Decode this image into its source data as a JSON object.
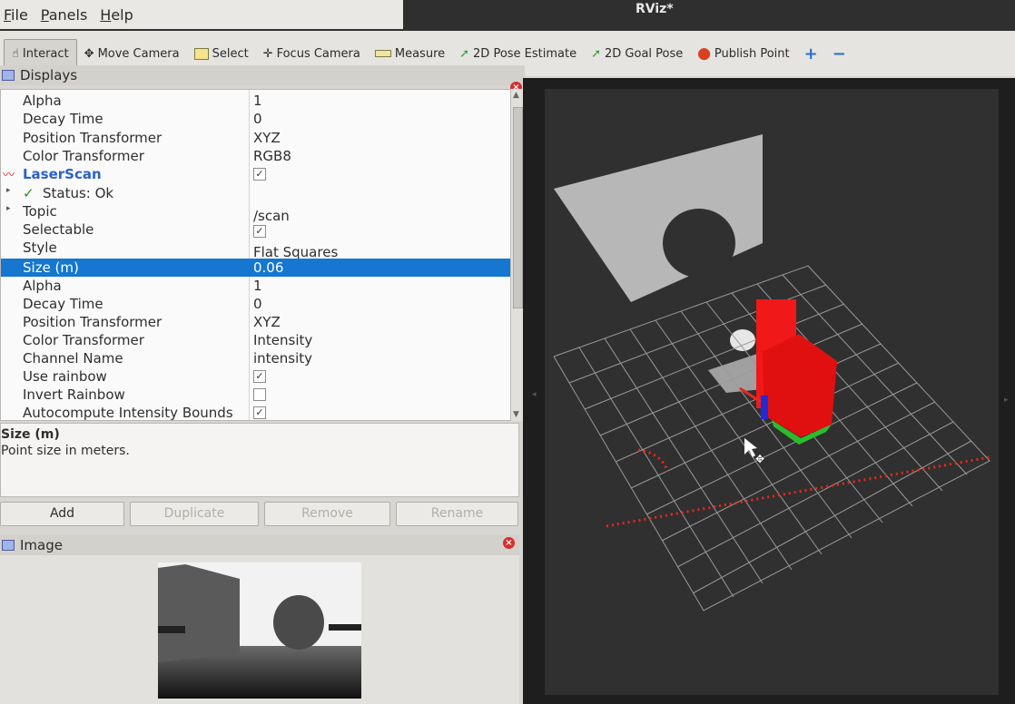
{
  "window": {
    "title": "RViz*"
  },
  "menu": [
    "File",
    "Panels",
    "Help"
  ],
  "toolbar": {
    "interact": "Interact",
    "move_camera": "Move Camera",
    "select": "Select",
    "focus_camera": "Focus Camera",
    "measure": "Measure",
    "pose_estimate": "2D Pose Estimate",
    "goal_pose": "2D Goal Pose",
    "publish_point": "Publish Point"
  },
  "displays": {
    "title": "Displays",
    "rows": [
      {
        "name": "Alpha",
        "value": "1"
      },
      {
        "name": "Decay Time",
        "value": "0"
      },
      {
        "name": "Position Transformer",
        "value": "XYZ"
      },
      {
        "name": "Color Transformer",
        "value": "RGB8"
      },
      {
        "name": "LaserScan",
        "value": "",
        "checked": true
      },
      {
        "name": "Status: Ok",
        "value": ""
      },
      {
        "name": "Topic",
        "value": "/scan"
      },
      {
        "name": "Selectable",
        "value": "",
        "checked": true
      },
      {
        "name": "Style",
        "value": "Flat Squares"
      },
      {
        "name": "Size (m)",
        "value": "0.06"
      },
      {
        "name": "Alpha",
        "value": "1"
      },
      {
        "name": "Decay Time",
        "value": "0"
      },
      {
        "name": "Position Transformer",
        "value": "XYZ"
      },
      {
        "name": "Color Transformer",
        "value": "Intensity"
      },
      {
        "name": "Channel Name",
        "value": "intensity"
      },
      {
        "name": "Use rainbow",
        "value": "",
        "checked": true
      },
      {
        "name": "Invert Rainbow",
        "value": "",
        "checked": false
      },
      {
        "name": "Autocompute Intensity Bounds",
        "value": "",
        "checked": true
      }
    ]
  },
  "description": {
    "title": "Size (m)",
    "text": "Point size in meters."
  },
  "buttons": {
    "add": "Add",
    "duplicate": "Duplicate",
    "remove": "Remove",
    "rename": "Rename"
  },
  "image_panel": {
    "title": "Image"
  },
  "colors": {
    "selection": "#1577cf",
    "laserscan": "#2a62c9",
    "robot": "#ff1a1a",
    "scan_points": "#e8281e"
  }
}
